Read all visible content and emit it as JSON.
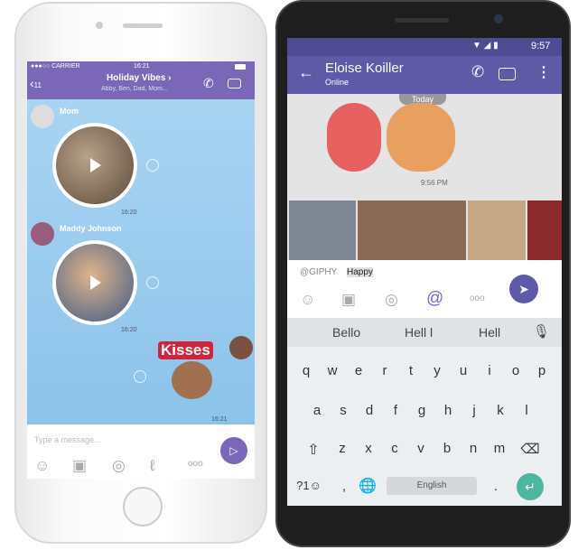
{
  "iphone": {
    "status": {
      "carrier": "●●●○○ CARRIER",
      "time": "16:21"
    },
    "header": {
      "back_count": "11",
      "title": "Holiday Vibes",
      "subtitle": "Abby, Ben, Dad, Mom..."
    },
    "messages": [
      {
        "sender": "Mom",
        "type": "video",
        "time": "16:20"
      },
      {
        "sender": "Maddy Johnson",
        "type": "video",
        "time": "16:20"
      },
      {
        "type": "sticker",
        "sticker_text": "Kisses",
        "time": "16:21"
      }
    ],
    "composer": {
      "placeholder": "Type a message..."
    },
    "accent": "#7b67b8"
  },
  "android": {
    "status": {
      "time": "9:57"
    },
    "header": {
      "title": "Eloise Koiller",
      "subtitle": "Online"
    },
    "chat": {
      "date_badge": "Today",
      "sticker_time": "9:56 PM"
    },
    "composer": {
      "prefix": "@GIPHY",
      "value": "Happy"
    },
    "suggestions": [
      "Bello",
      "Hell l",
      "Hell"
    ],
    "keyboard": {
      "row1": [
        "q",
        "w",
        "e",
        "r",
        "t",
        "y",
        "u",
        "i",
        "o",
        "p"
      ],
      "row2": [
        "a",
        "s",
        "d",
        "f",
        "g",
        "h",
        "j",
        "k",
        "l"
      ],
      "row3": [
        "z",
        "x",
        "c",
        "v",
        "b",
        "n",
        "m"
      ],
      "symbols": "?1☺",
      "comma": ",",
      "space": "English",
      "period": "."
    },
    "accent": "#5e5aa8",
    "enter_color": "#4db6a0"
  }
}
